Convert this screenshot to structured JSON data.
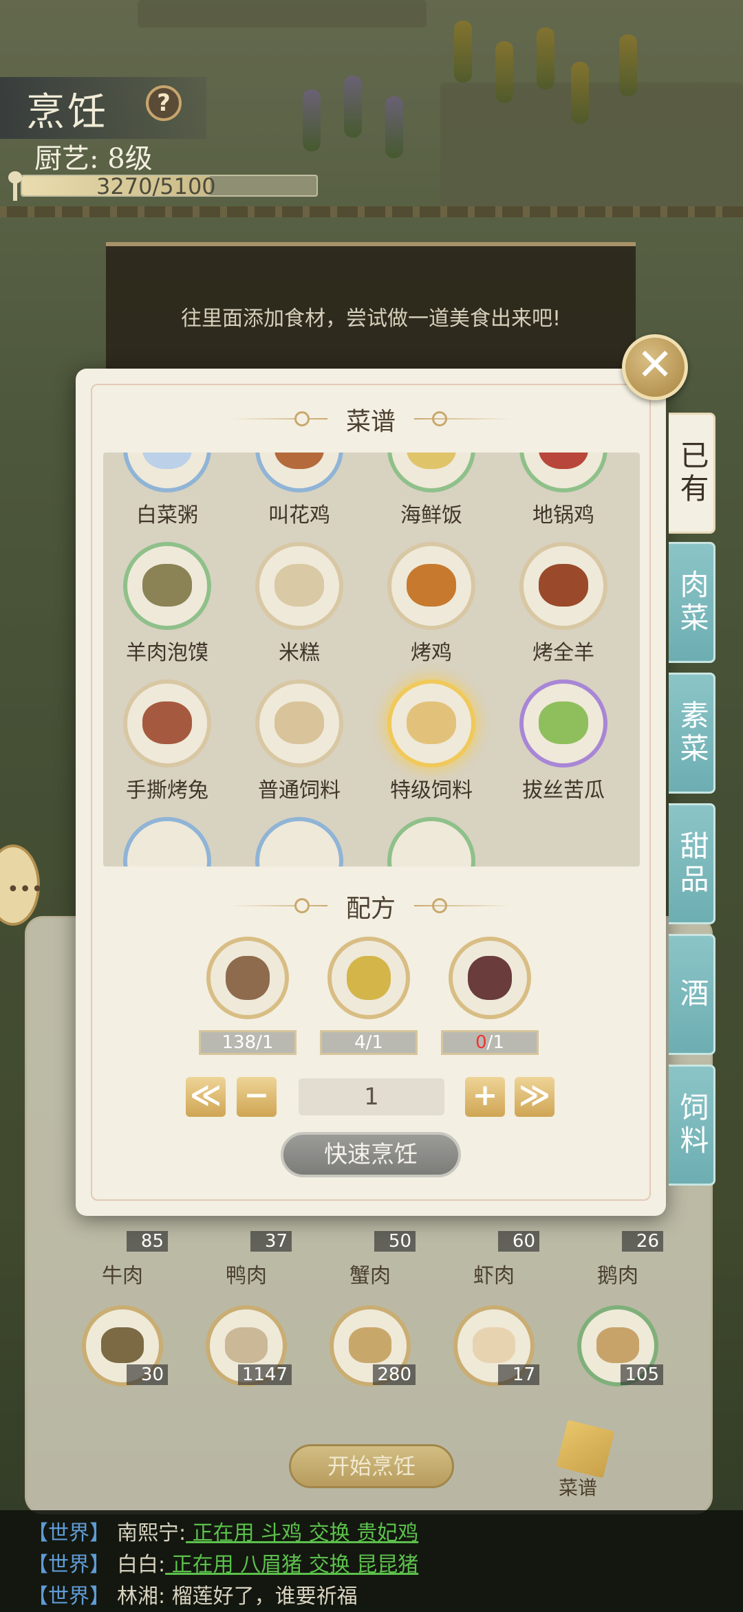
{
  "header": {
    "title": "烹饪",
    "help": "?",
    "chef_level": "厨艺: 8级",
    "exp_text": "3270/5100",
    "exp_fraction": 0.641
  },
  "banner": {
    "text": "往里面添加食材，尝试做一道美食出来吧!"
  },
  "dialog": {
    "recipe_title": "菜谱",
    "formula_title": "配方",
    "close": "✕",
    "dishes": [
      {
        "name": "白菜粥",
        "color": "#bcd0e8",
        "ring": "blue"
      },
      {
        "name": "叫花鸡",
        "color": "#b56a3b",
        "ring": "blue"
      },
      {
        "name": "海鲜饭",
        "color": "#e0c46a",
        "ring": "green"
      },
      {
        "name": "地锅鸡",
        "color": "#b9463a",
        "ring": "green"
      },
      {
        "name": "羊肉泡馍",
        "color": "#8b8256",
        "ring": "green"
      },
      {
        "name": "米糕",
        "color": "#d9c9a4",
        "ring": ""
      },
      {
        "name": "烤鸡",
        "color": "#c77a2e",
        "ring": ""
      },
      {
        "name": "烤全羊",
        "color": "#9a4a2a",
        "ring": ""
      },
      {
        "name": "手撕烤兔",
        "color": "#a55a3f",
        "ring": ""
      },
      {
        "name": "普通饲料",
        "color": "#d9c39a",
        "ring": ""
      },
      {
        "name": "特级饲料",
        "color": "#e2c27a",
        "ring": "gold"
      },
      {
        "name": "拔丝苦瓜",
        "color": "#8fbf5c",
        "ring": "purple"
      }
    ],
    "formula": [
      {
        "name": "mushroom",
        "have": "138",
        "need": "/1",
        "color": "#8d6b4c",
        "red": false
      },
      {
        "name": "durian",
        "have": "4",
        "need": "/1",
        "color": "#d4b54a",
        "red": false
      },
      {
        "name": "taro",
        "have": "0",
        "need": "/1",
        "color": "#6a3c3c",
        "red": true
      }
    ],
    "quantity": "1",
    "min_label": "≪",
    "minus_label": "−",
    "plus_label": "+",
    "max_label": "≫",
    "quick_cook": "快速烹饪"
  },
  "tabs": [
    {
      "label": "已有",
      "active": true
    },
    {
      "label": "肉菜",
      "active": false
    },
    {
      "label": "素菜",
      "active": false
    },
    {
      "label": "甜品",
      "active": false
    },
    {
      "label": "酒",
      "active": false
    },
    {
      "label": "饲料",
      "active": false
    }
  ],
  "ingredients_row1": [
    {
      "name": "牛肉",
      "count": "85"
    },
    {
      "name": "鸭肉",
      "count": "37"
    },
    {
      "name": "蟹肉",
      "count": "50"
    },
    {
      "name": "虾肉",
      "count": "60"
    },
    {
      "name": "鹅肉",
      "count": "26"
    }
  ],
  "ingredients_row2": [
    {
      "count": "30",
      "color": "#7c6a45"
    },
    {
      "count": "1147",
      "color": "#cbb896"
    },
    {
      "count": "280",
      "color": "#c8a86a"
    },
    {
      "count": "17",
      "color": "#e8d3b0"
    },
    {
      "count": "105",
      "color": "#c7a36a"
    }
  ],
  "start_cook": "开始烹饪",
  "recipe_book": "菜谱",
  "chat": [
    {
      "tag": "【世界】",
      "who": "南熙宁:",
      "msg": "",
      "link": "正在用 斗鸡 交换 贵妃鸡"
    },
    {
      "tag": "【世界】",
      "who": "白白:",
      "msg": "",
      "link": "正在用 八眉猪 交换 昆昆猪"
    },
    {
      "tag": "【世界】",
      "who": "林湘:",
      "msg": "榴莲好了，谁要祈福",
      "link": ""
    }
  ],
  "side_bubble": "•••"
}
